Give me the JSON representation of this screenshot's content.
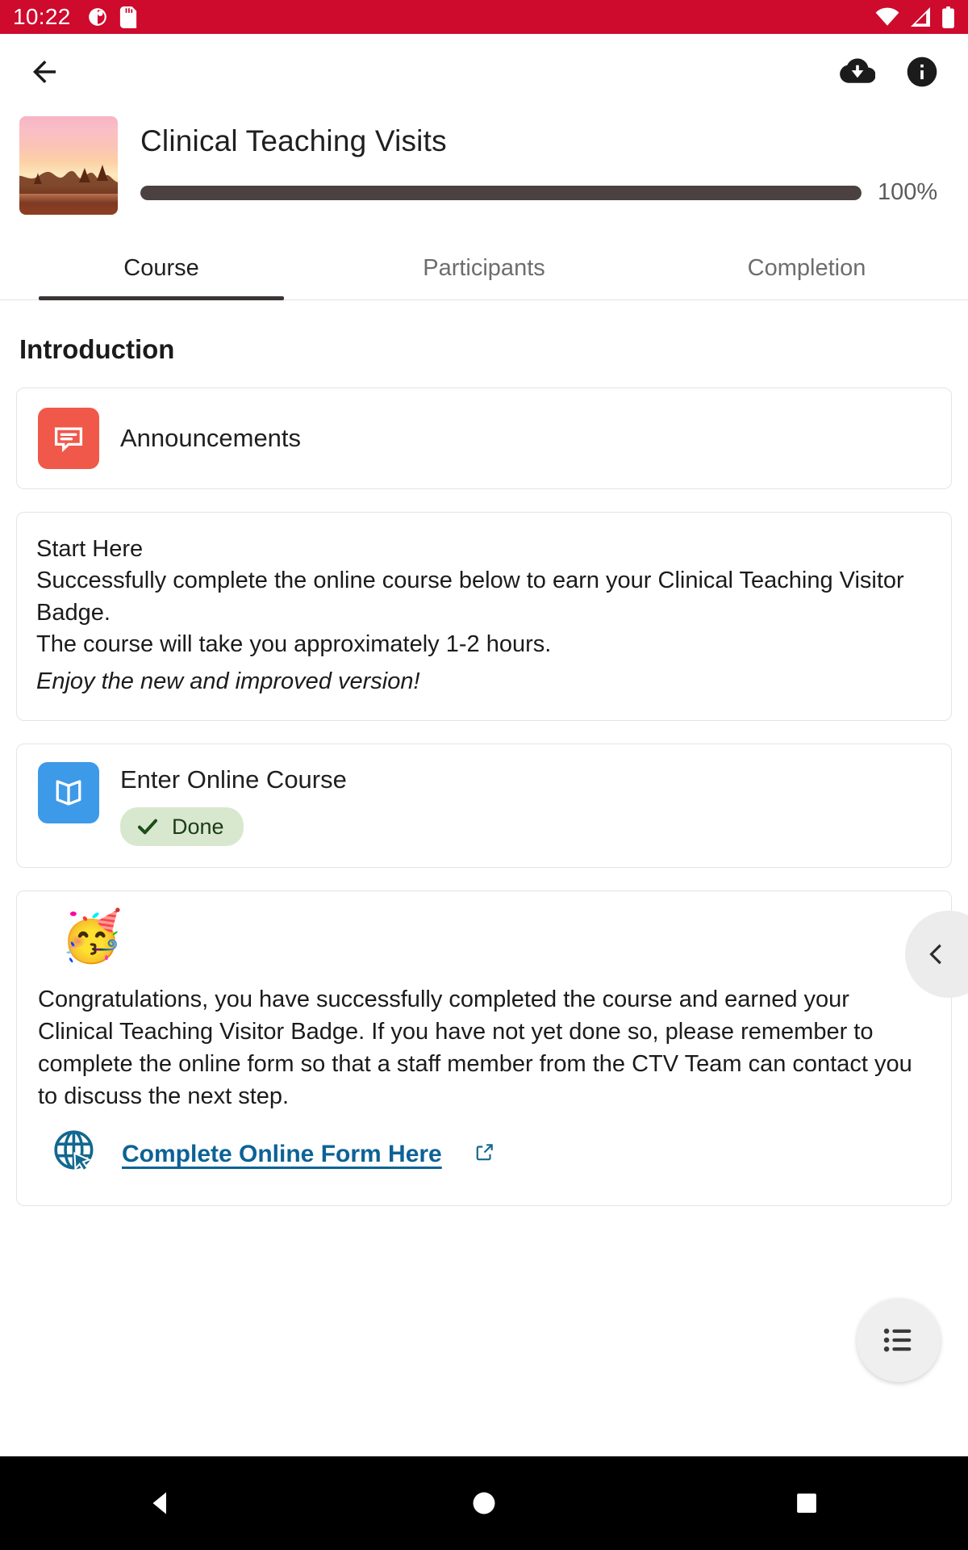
{
  "status_bar": {
    "time": "10:22",
    "icons_left": [
      "do-not-disturb-icon",
      "sd-card-icon"
    ],
    "icons_right": [
      "wifi-icon",
      "cellular-signal-icon",
      "battery-icon"
    ],
    "background_color": "#ce0a2d"
  },
  "app_bar": {
    "back_label": "back-arrow",
    "download_label": "download",
    "info_label": "info"
  },
  "course": {
    "title": "Clinical Teaching Visits",
    "progress_percent": 100,
    "progress_label": "100%",
    "thumbnail_alt": "sunset-landscape"
  },
  "tabs": [
    {
      "label": "Course",
      "active": true
    },
    {
      "label": "Participants",
      "active": false
    },
    {
      "label": "Completion",
      "active": false
    }
  ],
  "section": {
    "title": "Introduction"
  },
  "announcements": {
    "label": "Announcements",
    "icon": "forum-icon",
    "icon_color": "#f0584a"
  },
  "intro_text": {
    "line1": " Start Here",
    "line2": "Successfully complete the online course below to earn your Clinical Teaching Visitor Badge.",
    "line3": "The course will take you approximately 1-2 hours.",
    "line4": "Enjoy the new and improved version!"
  },
  "enter_course": {
    "title": "Enter Online Course",
    "icon": "book-icon",
    "icon_color": "#3d9ae8",
    "status_label": "Done",
    "status_icon": "check-icon",
    "status_bg": "#d8e8cf",
    "status_color": "#1d3b16"
  },
  "congrats": {
    "emoji": "🥳",
    "body": "Congratulations, you have successfully completed the course and earned your Clinical Teaching Visitor Badge. If you have not yet done so, please remember to complete the online form so that a staff member from the CTV Team can contact you to discuss the next step.",
    "link_text": "Complete Online Form Here",
    "link_color": "#0c6296",
    "link_icon": "globe-cursor-icon",
    "external_icon": "external-link-icon"
  },
  "floating": {
    "side_handle_icon": "chevron-left-icon",
    "fab_icon": "list-icon"
  },
  "nav_bar": {
    "back_icon": "triangle-back-icon",
    "home_icon": "circle-home-icon",
    "recents_icon": "square-recents-icon"
  }
}
